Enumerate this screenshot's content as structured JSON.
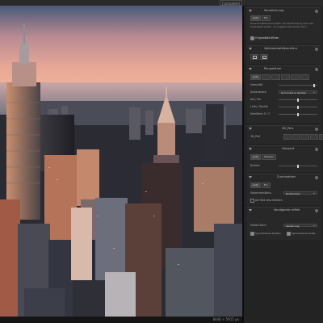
{
  "app": {
    "top_label": "[complete]",
    "status_text": "8648 × 5915 px"
  },
  "panel": {
    "s1": {
      "title": "Verzeichnung",
      "buttons": [
        "Auto",
        "Ein"
      ],
      "text": "Die automatische Korrektur der Verzeichnung muss das Originalbild prüfen, um angewendet werden kann.",
      "link": "Originalbild öffnen"
    },
    "s2": {
      "title": "Vollautomatikkorrektur"
    },
    "s3": {
      "title": "Perspektive",
      "buttons": [
        "Auto",
        "",
        "",
        "",
        "",
        ""
      ],
      "row_labels": [
        "Intensität",
        "Automatisch",
        "Auf / Ab",
        "Links / Rechts",
        "Verhältnis X / Y"
      ],
      "auto_select": "Horizontal & Vertikal",
      "slider_levels": [
        0.92,
        0.5,
        0.5,
        0.5
      ]
    },
    "s4": {
      "title": "3D_Pers",
      "row_label": "3D_Perf"
    },
    "s5": {
      "title": "Horizont",
      "buttons": [
        "Auto",
        "Flexibel"
      ],
      "row_label": "Drehen",
      "slider_level": 0.5
    },
    "s6": {
      "title": "Zuschneiden",
      "buttons": [
        "Auto",
        "Ein"
      ],
      "row_label": "Seitenverhältnis",
      "select_value": "Beibehalten",
      "checkbox_label": "Auf Bild beschränken"
    },
    "s7": {
      "title": "Verzögerter effekt",
      "row_label": "Modell-Form",
      "select_value": "Verzerrung",
      "checkbox1_label": "Symmetrische Position",
      "checkbox2_label": "Symmetrische Größe"
    }
  }
}
